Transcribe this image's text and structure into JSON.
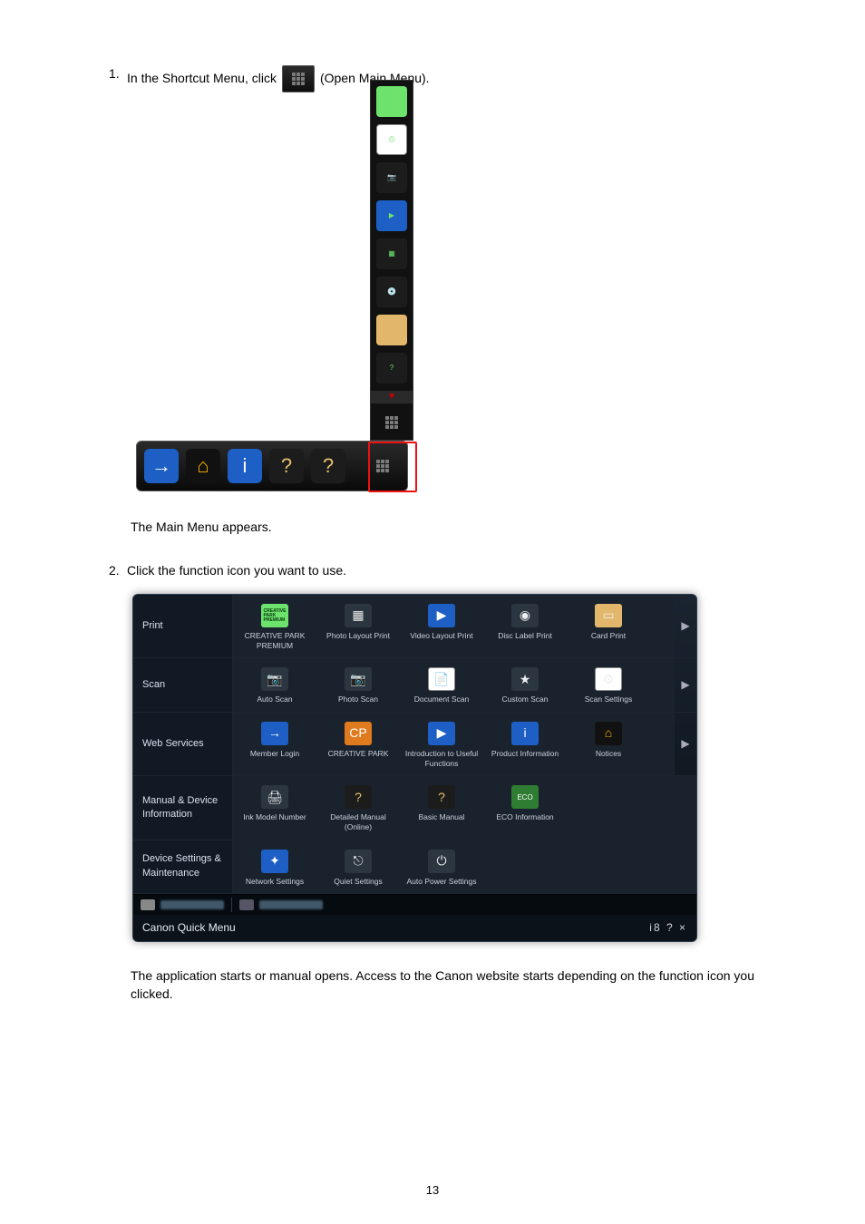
{
  "steps": {
    "s1_num": "1.",
    "s1_a": "In the Shortcut Menu, click",
    "s1_b": "(Open Main Menu).",
    "s1_after": "The Main Menu appears.",
    "s2_num": "2.",
    "s2": "Click the function icon you want to use.",
    "s2_after": "The application starts or manual opens. Access to the Canon website starts depending on the function icon you clicked."
  },
  "popup_items": [
    "CREATIVE PARK PREMIUM",
    "scan-settings-icon",
    "auto-scan-icon",
    "video-layout-icon",
    "photo-layout-icon",
    "disc-label-icon",
    "card-print-icon",
    "basic-manual-icon"
  ],
  "main_menu": {
    "title": "Canon Quick Menu",
    "rows": [
      {
        "label": "Print",
        "arrow": true,
        "items": [
          {
            "caption": "CREATIVE PARK PREMIUM",
            "icon": "creative-park-icon",
            "cls": "ic-creative"
          },
          {
            "caption": "Photo Layout Print",
            "icon": "photo-layout-icon",
            "cls": ""
          },
          {
            "caption": "Video Layout Print",
            "icon": "video-layout-icon",
            "cls": "ic-blue"
          },
          {
            "caption": "Disc Label Print",
            "icon": "disc-label-icon",
            "cls": ""
          },
          {
            "caption": "Card Print",
            "icon": "card-print-icon",
            "cls": "ic-paper2"
          }
        ]
      },
      {
        "label": "Scan",
        "arrow": true,
        "items": [
          {
            "caption": "Auto Scan",
            "icon": "auto-scan-icon",
            "cls": ""
          },
          {
            "caption": "Photo Scan",
            "icon": "photo-scan-icon",
            "cls": ""
          },
          {
            "caption": "Document Scan",
            "icon": "document-scan-icon",
            "cls": "ic-photo"
          },
          {
            "caption": "Custom Scan",
            "icon": "custom-scan-icon",
            "cls": ""
          },
          {
            "caption": "Scan Settings",
            "icon": "scan-settings-icon",
            "cls": "ic-photo"
          }
        ]
      },
      {
        "label": "Web Services",
        "arrow": true,
        "items": [
          {
            "caption": "Member Login",
            "icon": "member-login-icon",
            "cls": "ic-blue"
          },
          {
            "caption": "CREATIVE PARK",
            "icon": "creative-park-web-icon",
            "cls": "ic-orange"
          },
          {
            "caption": "Introduction to Useful Functions",
            "icon": "intro-functions-icon",
            "cls": "ic-blue"
          },
          {
            "caption": "Product Information",
            "icon": "product-info-icon",
            "cls": "ic-blue"
          },
          {
            "caption": "Notices",
            "icon": "notices-icon",
            "cls": "ic-wifi"
          }
        ]
      },
      {
        "label": "Manual & Device Information",
        "arrow": false,
        "items": [
          {
            "caption": "Ink Model Number",
            "icon": "ink-model-icon",
            "cls": ""
          },
          {
            "caption": "Detailed Manual (Online)",
            "icon": "detailed-manual-icon",
            "cls": "ic-help"
          },
          {
            "caption": "Basic Manual",
            "icon": "basic-manual-icon",
            "cls": "ic-help"
          },
          {
            "caption": "ECO Information",
            "icon": "eco-info-icon",
            "cls": "ic-green"
          }
        ]
      },
      {
        "label": "Device Settings & Maintenance",
        "arrow": false,
        "items": [
          {
            "caption": "Network Settings",
            "icon": "network-settings-icon",
            "cls": "ic-blue"
          },
          {
            "caption": "Quiet Settings",
            "icon": "quiet-settings-icon",
            "cls": ""
          },
          {
            "caption": "Auto Power Settings",
            "icon": "auto-power-icon",
            "cls": ""
          }
        ]
      }
    ],
    "controls": "i8  ?  ×"
  },
  "page_number": "13"
}
